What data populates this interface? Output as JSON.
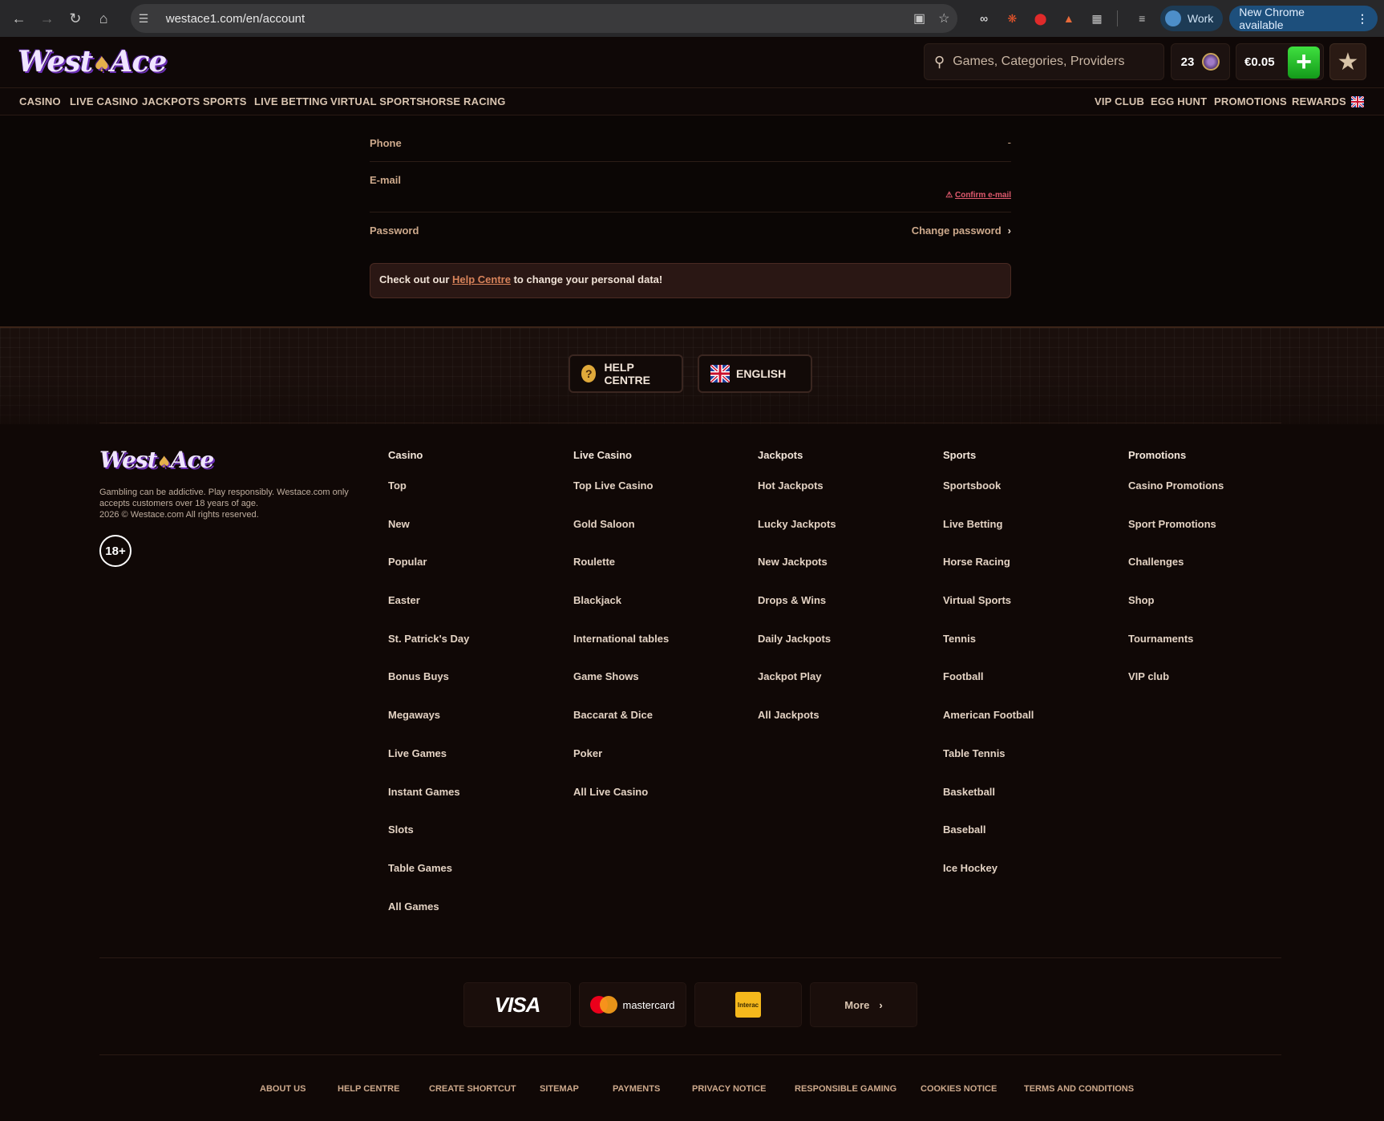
{
  "browser": {
    "url": "westace1.com/en/account",
    "profile_label": "Work",
    "update_label": "New Chrome available"
  },
  "header": {
    "logo_text_1": "West",
    "logo_text_2": "Ace",
    "search_placeholder": "Games, Categories, Providers",
    "coins": "23",
    "balance": "€0.05"
  },
  "nav_left": [
    "CASINO",
    "LIVE CASINO",
    "JACKPOTS",
    "SPORTS",
    "LIVE BETTING",
    "VIRTUAL SPORTS",
    "HORSE RACING"
  ],
  "nav_right": [
    "VIP CLUB",
    "EGG HUNT",
    "PROMOTIONS",
    "REWARDS"
  ],
  "account": {
    "phone_label": "Phone",
    "phone_value": "-",
    "email_label": "E-mail",
    "confirm_email": "Confirm e-mail",
    "password_label": "Password",
    "change_password": "Change password",
    "notice_prefix": "Check out our ",
    "notice_link": "Help Centre",
    "notice_suffix": " to change your personal data!"
  },
  "footer": {
    "help_centre": "HELP CENTRE",
    "language": "ENGLISH",
    "disclaimer_1": "Gambling can be addictive. Play responsibly. Westace.com only accepts customers over 18 years of age.",
    "disclaimer_2": "2026 © Westace.com All rights reserved.",
    "age_badge": "18+",
    "columns": [
      {
        "title": "Casino",
        "links": [
          "Top",
          "New",
          "Popular",
          "Easter",
          "St. Patrick's Day",
          "Bonus Buys",
          "Megaways",
          "Live Games",
          "Instant Games",
          "Slots",
          "Table Games",
          "All Games"
        ]
      },
      {
        "title": "Live Casino",
        "links": [
          "Top Live Casino",
          "Gold Saloon",
          "Roulette",
          "Blackjack",
          "International tables",
          "Game Shows",
          "Baccarat & Dice",
          "Poker",
          "All Live Casino"
        ]
      },
      {
        "title": "Jackpots",
        "links": [
          "Hot Jackpots",
          "Lucky Jackpots",
          "New Jackpots",
          "Drops & Wins",
          "Daily Jackpots",
          "Jackpot Play",
          "All Jackpots"
        ]
      },
      {
        "title": "Sports",
        "links": [
          "Sportsbook",
          "Live Betting",
          "Horse Racing",
          "Virtual Sports",
          "Tennis",
          "Football",
          "American Football",
          "Table Tennis",
          "Basketball",
          "Baseball",
          "Ice Hockey"
        ]
      },
      {
        "title": "Promotions",
        "links": [
          "Casino Promotions",
          "Sport Promotions",
          "Challenges",
          "Shop",
          "Tournaments",
          "VIP club"
        ]
      }
    ],
    "payments": {
      "visa": "VISA",
      "mastercard": "mastercard",
      "interac": "Interac",
      "more": "More"
    },
    "bottom_links": [
      "ABOUT US",
      "HELP CENTRE",
      "CREATE SHORTCUT",
      "SITEMAP",
      "PAYMENTS",
      "PRIVACY NOTICE",
      "RESPONSIBLE GAMING",
      "COOKIES NOTICE",
      "TERMS AND CONDITIONS"
    ]
  },
  "colors": {
    "background": "#0b0605",
    "accent_link": "#d8835a",
    "warning": "#e05a6e",
    "deposit_green": "#2fc22f"
  }
}
